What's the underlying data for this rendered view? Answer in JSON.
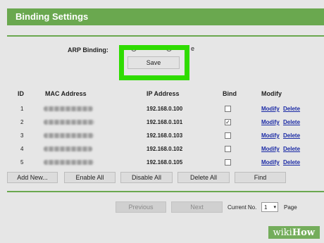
{
  "header": {
    "title": "Binding Settings"
  },
  "arp": {
    "label": "ARP Binding:",
    "option_tail": "e"
  },
  "save_label": "Save",
  "table": {
    "columns": [
      "ID",
      "MAC Address",
      "IP Address",
      "Bind",
      "Modify"
    ],
    "rows": [
      {
        "id": "1",
        "ip": "192.168.0.100",
        "bind": "",
        "modify": "Modify",
        "delete": "Delete"
      },
      {
        "id": "2",
        "ip": "192.168.0.101",
        "bind": "✓",
        "modify": "Modify",
        "delete": "Delete"
      },
      {
        "id": "3",
        "ip": "192.168.0.103",
        "bind": "",
        "modify": "Modify",
        "delete": "Delete"
      },
      {
        "id": "4",
        "ip": "192.168.0.102",
        "bind": "",
        "modify": "Modify",
        "delete": "Delete"
      },
      {
        "id": "5",
        "ip": "192.168.0.105",
        "bind": "",
        "modify": "Modify",
        "delete": "Delete"
      }
    ]
  },
  "actions": {
    "add_new": "Add New...",
    "enable_all": "Enable All",
    "disable_all": "Disable All",
    "delete_all": "Delete All",
    "find": "Find"
  },
  "pager": {
    "previous": "Previous",
    "next": "Next",
    "current_label": "Current No.",
    "current_value": "1",
    "page_label": "Page"
  },
  "watermark": {
    "wiki": "wiki",
    "how": "How"
  },
  "colors": {
    "accent": "#6aa84f",
    "highlight": "#2fdc00",
    "link": "#1a2aa5"
  }
}
